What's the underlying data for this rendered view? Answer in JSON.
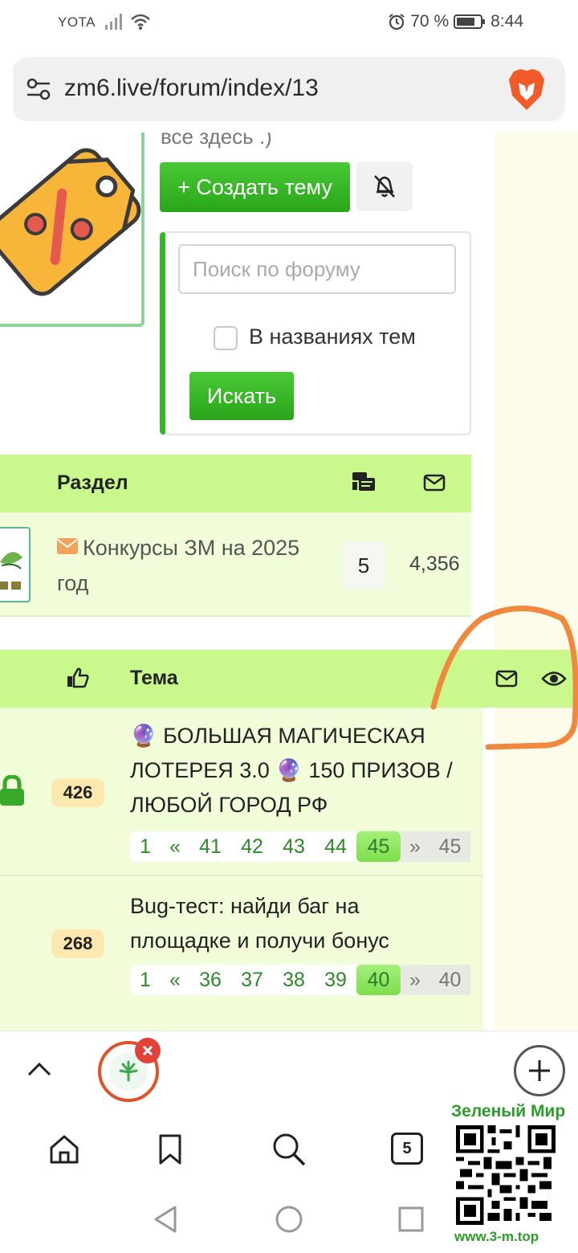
{
  "status_bar": {
    "carrier": "YOTA",
    "battery": "70 %",
    "time": "8:44"
  },
  "browser": {
    "url": "zm6.live/forum/index/13",
    "tab_count": "5"
  },
  "forum": {
    "intro_text": "все здесь .)",
    "create_topic_label": "+ Создать тему",
    "search": {
      "placeholder": "Поиск по форуму",
      "checkbox_label": "В названиях тем",
      "button_label": "Искать"
    },
    "sections_table": {
      "header_section": "Раздел",
      "rows": [
        {
          "title": "Конкурсы ЗМ на 2025 год",
          "topics": "5",
          "messages": "4,356"
        }
      ]
    },
    "topics_table": {
      "header_topic": "Тема",
      "rows": [
        {
          "likes": "426",
          "title_line1": "🔮 БОЛЬШАЯ МАГИЧЕСКАЯ",
          "title_line2": "ЛОТЕРЕЯ 3.0 🔮 150 ПРИЗОВ /",
          "title_line3": "ЛЮБОЙ ГОРОД РФ",
          "pager": [
            "1",
            "«",
            "41",
            "42",
            "43",
            "44",
            "45",
            "»",
            "45"
          ]
        },
        {
          "likes": "268",
          "title_line1": "Bug-тест: найди баг на",
          "title_line2": "площадке и получи бонус",
          "pager": [
            "1",
            "«",
            "36",
            "37",
            "38",
            "39",
            "40",
            "»",
            "40"
          ]
        }
      ]
    }
  },
  "watermark": {
    "title": "Зеленый Мир",
    "url": "www.3-m.top"
  },
  "colors": {
    "accent_green": "#39b52a",
    "header_green": "#c9f88c",
    "row_green": "#f1fcd9",
    "annotation_orange": "#f0883e"
  }
}
